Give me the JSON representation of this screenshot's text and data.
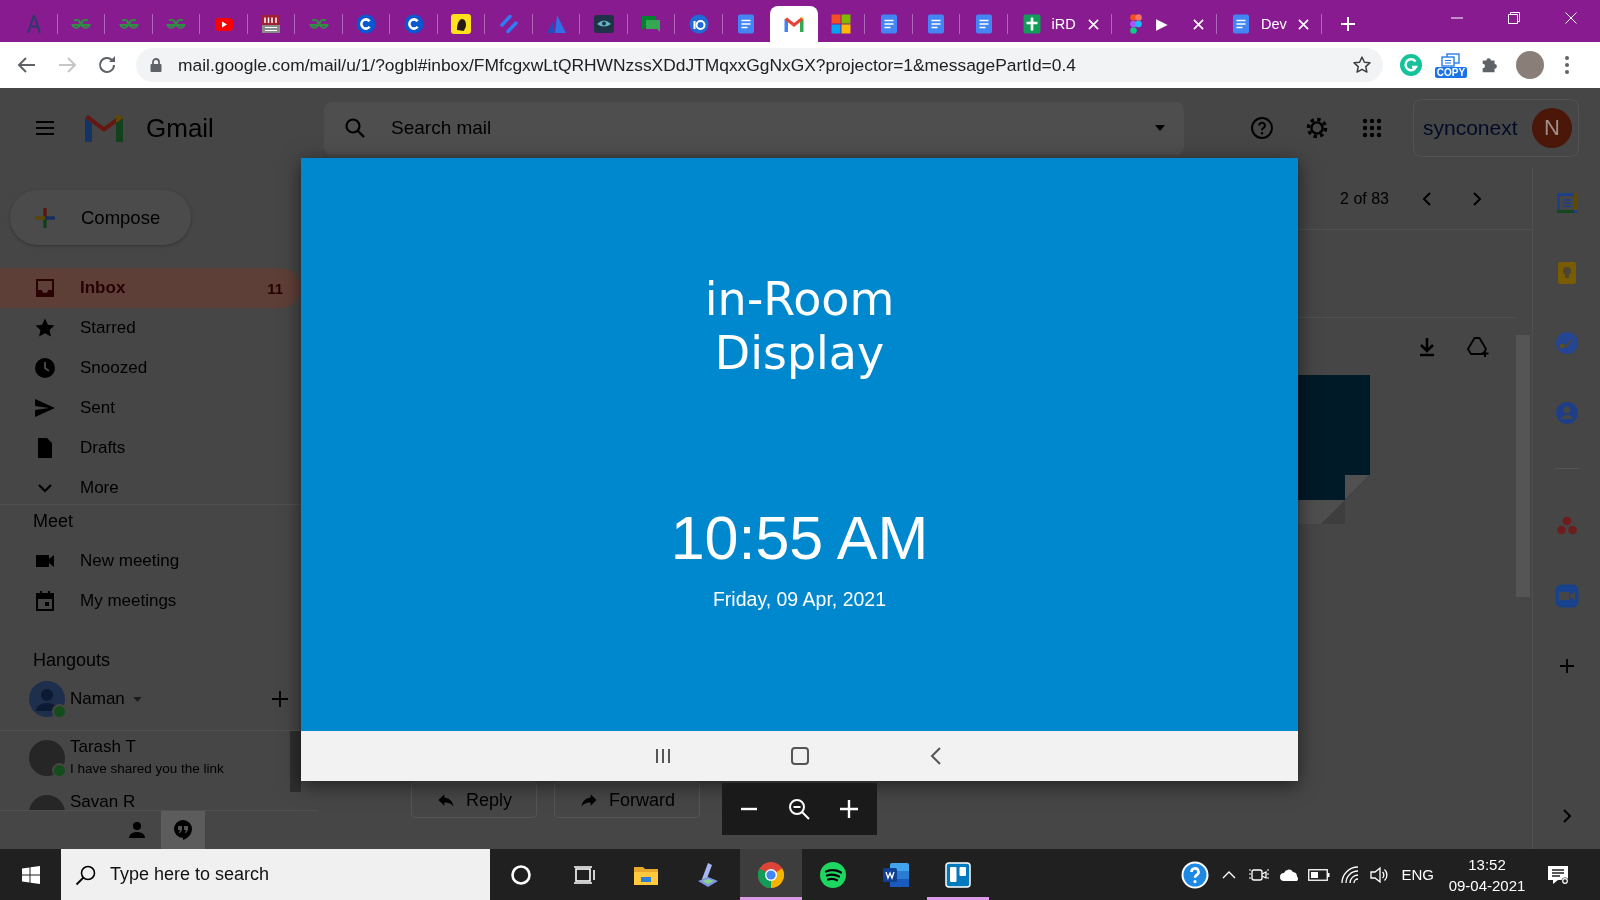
{
  "browser": {
    "tabs": [
      {
        "kind": "compass",
        "selected": false,
        "closable": false
      },
      {
        "kind": "loops",
        "selected": false,
        "closable": false
      },
      {
        "kind": "loops",
        "selected": false,
        "closable": false
      },
      {
        "kind": "loops",
        "selected": false,
        "closable": false
      },
      {
        "kind": "play",
        "selected": false,
        "closable": false
      },
      {
        "kind": "tile",
        "selected": false,
        "closable": false
      },
      {
        "kind": "loops",
        "selected": false,
        "closable": false
      },
      {
        "kind": "c-circle",
        "selected": false,
        "closable": false
      },
      {
        "kind": "c-circle",
        "selected": false,
        "closable": false
      },
      {
        "kind": "face-tile",
        "selected": false,
        "closable": false
      },
      {
        "kind": "stripes",
        "selected": false,
        "closable": false
      },
      {
        "kind": "triangle",
        "selected": false,
        "closable": false
      },
      {
        "kind": "eye",
        "selected": false,
        "closable": false
      },
      {
        "kind": "chat",
        "selected": false,
        "closable": false
      },
      {
        "kind": "ring-badge",
        "selected": false,
        "closable": false
      },
      {
        "kind": "document",
        "selected": false,
        "closable": false
      },
      {
        "kind": "mail",
        "selected": true,
        "closable": false
      },
      {
        "kind": "squares",
        "selected": false,
        "closable": false
      },
      {
        "kind": "document",
        "selected": false,
        "closable": false
      },
      {
        "kind": "document",
        "selected": false,
        "closable": false
      },
      {
        "kind": "document",
        "selected": false,
        "closable": false
      },
      {
        "kind": "spreadsheet",
        "title": "iRD",
        "selected": false,
        "closable": true
      },
      {
        "kind": "dots",
        "title": "▶",
        "selected": false,
        "closable": true
      },
      {
        "kind": "document",
        "title": "Dev",
        "selected": false,
        "closable": true
      }
    ],
    "nav": [
      {
        "kind": "back",
        "disabled": false
      },
      {
        "kind": "forward",
        "disabled": true
      },
      {
        "kind": "reload",
        "disabled": false
      }
    ],
    "url": "mail.google.com/mail/u/1/?ogbl#inbox/FMfcgxwLtQRHWNzssXDdJTMqxxGgNxGX?projector=1&messagePartId=0.4",
    "extension_badge": "COPY"
  },
  "gmail": {
    "header": {
      "product": "Gmail",
      "search": {
        "placeholder": "Search mail"
      },
      "organization": "synconext",
      "account_initial": "N"
    },
    "compose": "Compose",
    "folders": [
      {
        "kind": "inbox",
        "label": "Inbox",
        "count": "11",
        "selected": true
      },
      {
        "kind": "starred",
        "label": "Starred",
        "selected": false
      },
      {
        "kind": "snoozed",
        "label": "Snoozed",
        "selected": false
      },
      {
        "kind": "sent",
        "label": "Sent",
        "selected": false
      },
      {
        "kind": "drafts",
        "label": "Drafts",
        "selected": false
      },
      {
        "kind": "more",
        "label": "More",
        "selected": false
      }
    ],
    "meet": {
      "title": "Meet",
      "items": [
        {
          "kind": "new-meeting",
          "label": "New meeting"
        },
        {
          "kind": "my-meetings",
          "label": "My meetings"
        }
      ]
    },
    "hangouts": {
      "title": "Hangouts",
      "me": {
        "name": "Naman",
        "online": true
      },
      "conversations": [
        {
          "name": "Tarash T",
          "preview": "I have shared you the link",
          "online": true
        },
        {
          "name": "Savan R"
        }
      ],
      "tabs": [
        {
          "kind": "contacts",
          "selected": false
        },
        {
          "kind": "chat",
          "selected": true
        }
      ]
    },
    "pager": "2 of 83",
    "actions": [
      {
        "kind": "reply",
        "label": "Reply"
      },
      {
        "kind": "forward",
        "label": "Forward"
      }
    ]
  },
  "viewer": {
    "title": "in-Room Display",
    "time": "10:55 AM",
    "date": "Friday, 09 Apr, 2021"
  },
  "taskbar": {
    "search": {
      "placeholder": "Type here to search"
    },
    "apps": [
      {
        "kind": "folder",
        "selected": false,
        "running": false
      },
      {
        "kind": "scanner",
        "selected": false,
        "running": false
      },
      {
        "kind": "browser",
        "selected": true,
        "running": true
      },
      {
        "kind": "music",
        "selected": false,
        "running": false
      },
      {
        "kind": "word",
        "selected": false,
        "running": false
      },
      {
        "kind": "board",
        "selected": false,
        "running": true
      }
    ],
    "tray": {
      "language": "ENG",
      "time": "13:52",
      "date": "09-04-2021"
    }
  }
}
